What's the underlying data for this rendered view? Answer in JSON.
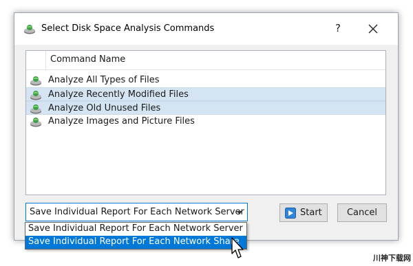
{
  "window": {
    "title": "Select Disk Space Analysis Commands",
    "help_label": "?",
    "title_icon": "disk-analysis-icon"
  },
  "list": {
    "column_header": "Command Name",
    "rows": [
      {
        "label": "Analyze All Types of Files",
        "selected": false,
        "icon": "disk-analysis-icon"
      },
      {
        "label": "Analyze Recently Modified Files",
        "selected": true,
        "icon": "disk-analysis-icon"
      },
      {
        "label": "Analyze Old Unused Files",
        "selected": true,
        "icon": "disk-analysis-icon"
      },
      {
        "label": "Analyze Images and Picture Files",
        "selected": false,
        "icon": "disk-analysis-icon"
      }
    ]
  },
  "report_mode": {
    "selected": "Save Individual Report For Each Network Server",
    "options": [
      {
        "label": "Save Individual Report For Each Network Server",
        "highlighted": false
      },
      {
        "label": "Save Individual Report For Each Network Share",
        "highlighted": true
      }
    ]
  },
  "buttons": {
    "start_label": "Start",
    "cancel_label": "Cancel"
  },
  "watermark": "川神下载网",
  "colors": {
    "accent": "#0078d7",
    "selection": "#d5e4f2",
    "dialog_bg": "#f0f0f0"
  }
}
